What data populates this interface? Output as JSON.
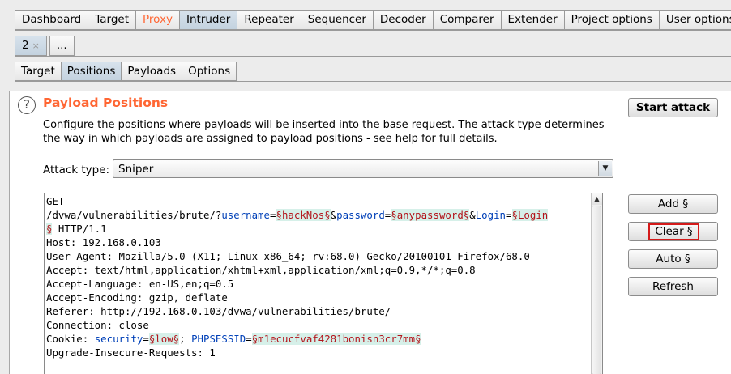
{
  "main_tabs": [
    {
      "label": "Dashboard"
    },
    {
      "label": "Target"
    },
    {
      "label": "Proxy"
    },
    {
      "label": "Intruder"
    },
    {
      "label": "Repeater"
    },
    {
      "label": "Sequencer"
    },
    {
      "label": "Decoder"
    },
    {
      "label": "Comparer"
    },
    {
      "label": "Extender"
    },
    {
      "label": "Project options"
    },
    {
      "label": "User options"
    }
  ],
  "attack_tabs": {
    "current": "2",
    "close": "×",
    "more": "..."
  },
  "pane_tabs": [
    {
      "label": "Target"
    },
    {
      "label": "Positions"
    },
    {
      "label": "Payloads"
    },
    {
      "label": "Options"
    }
  ],
  "panel": {
    "title": "Payload Positions",
    "description": "Configure the positions where payloads will be inserted into the base request. The attack type determines the way in which payloads are assigned to payload positions - see help for full details.",
    "attack_type_label": "Attack type:",
    "attack_type_value": "Sniper",
    "help_glyph": "?"
  },
  "buttons": {
    "start_attack": "Start attack",
    "add": "Add §",
    "clear": "Clear §",
    "auto": "Auto §",
    "refresh": "Refresh"
  },
  "request": {
    "line_1": "GET",
    "path": "/dvwa/vulnerabilities/brute/?",
    "p_username_key": "username",
    "p_username_val": "§hackNos§",
    "p_password_key": "password",
    "p_password_val": "§anypassword§",
    "p_login_key": "Login",
    "p_login_val_1": "§Login",
    "p_login_val_2": "§",
    "protocol": " HTTP/1.1",
    "host": "Host: 192.168.0.103",
    "user_agent": "User-Agent: Mozilla/5.0 (X11; Linux x86_64; rv:68.0) Gecko/20100101 Firefox/68.0",
    "accept": "Accept: text/html,application/xhtml+xml,application/xml;q=0.9,*/*;q=0.8",
    "accept_language": "Accept-Language: en-US,en;q=0.5",
    "accept_encoding": "Accept-Encoding: gzip, deflate",
    "referer": "Referer: http://192.168.0.103/dvwa/vulnerabilities/brute/",
    "connection": "Connection: close",
    "cookie_prefix": "Cookie: ",
    "cookie_security_key": "security",
    "cookie_security_val": "§low§",
    "cookie_sess_key": "PHPSESSID",
    "cookie_sess_val": "§m1ecucfvaf4281bonisn3cr7mm§",
    "upgrade": "Upgrade-Insecure-Requests: 1"
  },
  "colors": {
    "accent": "#ff6633",
    "param_key": "#0040b8",
    "payload_text": "#b3141b",
    "payload_bg": "#d6f0e9",
    "highlight_border": "#d41a1a"
  }
}
